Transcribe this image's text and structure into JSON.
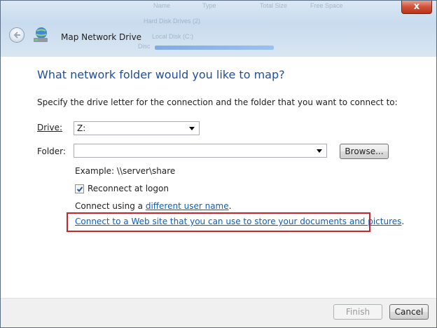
{
  "window": {
    "title": "Map Network Drive",
    "close_glyph": "x"
  },
  "background_blur": {
    "col1": "Name",
    "col2": "Type",
    "col3": "Total Size",
    "col4": "Free Space",
    "row1": "Hard Disk Drives (2)",
    "row2": "Local Disk (C:)",
    "row3": "Disc"
  },
  "dialog": {
    "heading": "What network folder would you like to map?",
    "instruction": "Specify the drive letter for the connection and the folder that you want to connect to:",
    "drive_label": "Drive:",
    "drive_value": "Z:",
    "folder_label": "Folder:",
    "folder_value": "",
    "browse_label": "Browse...",
    "example": "Example: \\\\server\\share",
    "reconnect_label": "Reconnect at logon",
    "reconnect_checked": true,
    "connect_prefix": "Connect using a ",
    "connect_link": "different user name",
    "connect_suffix": ".",
    "web_link": "Connect to a Web site that you can use to store your documents and pictures",
    "web_suffix": "."
  },
  "footer": {
    "finish_label": "Finish",
    "cancel_label": "Cancel"
  },
  "colors": {
    "heading": "#1f4e9c",
    "link": "#0a5ec6",
    "highlight_border": "#c9242b"
  },
  "icons": {
    "back": "back-arrow-icon",
    "network_drive": "network-drive-icon",
    "check": "check-icon",
    "dropdown": "chevron-down-icon"
  }
}
